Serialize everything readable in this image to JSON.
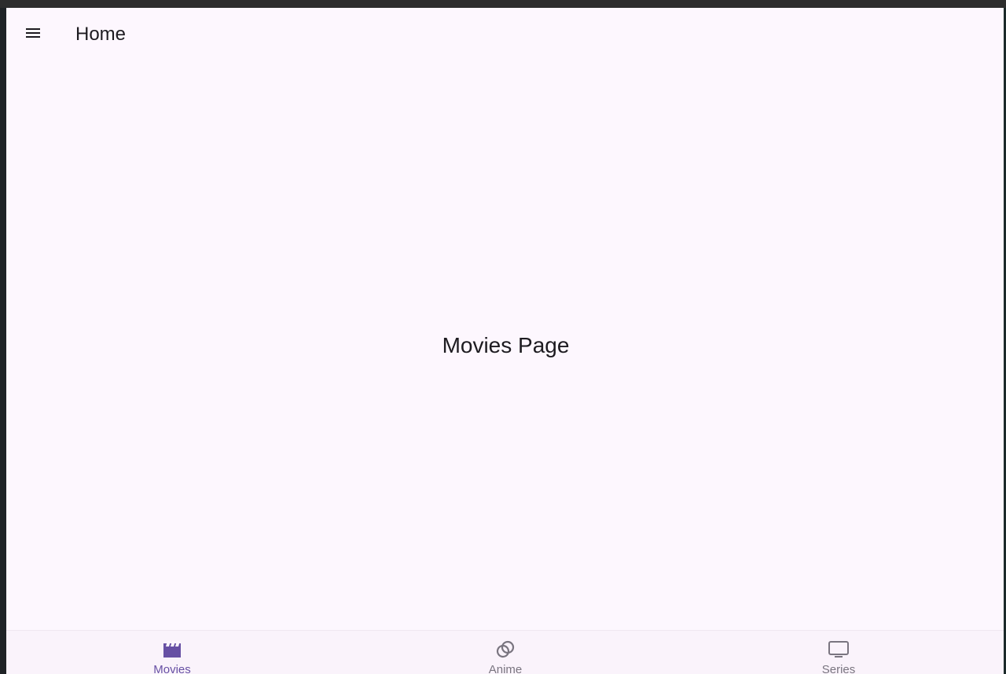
{
  "app_bar": {
    "title": "Home",
    "menu_icon": "hamburger-menu-icon"
  },
  "main": {
    "page_label": "Movies Page"
  },
  "bottom_nav": {
    "items": [
      {
        "label": "Movies",
        "icon": "movie-clapper-icon",
        "active": true
      },
      {
        "label": "Anime",
        "icon": "rings-icon",
        "active": false
      },
      {
        "label": "Series",
        "icon": "tv-icon",
        "active": false
      }
    ]
  },
  "colors": {
    "background": "#fdf7fe",
    "accent": "#6750a4",
    "text": "#1d1b20",
    "inactive": "#7a7580"
  }
}
